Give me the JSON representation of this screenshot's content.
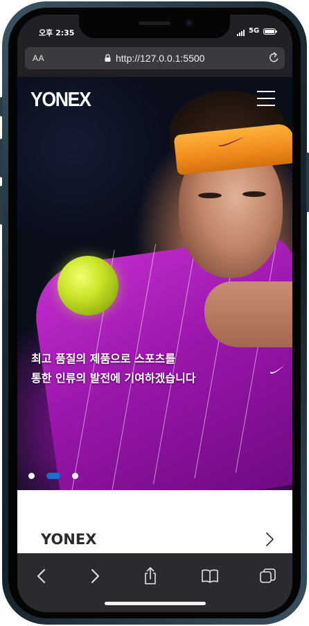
{
  "status_bar": {
    "time": "오후 2:35",
    "network": "5G"
  },
  "browser": {
    "text_size_label": "AA",
    "url": "http://127.0.0.1:5500"
  },
  "header": {
    "logo": "YONEX"
  },
  "hero": {
    "tagline_line1": "최고 품질의 제품으로 스포츠를",
    "tagline_line2": "통한 인류의 발전에 기여하겠습니다",
    "slides_total": 3,
    "active_slide": 2
  },
  "section": {
    "title": "YONEX"
  },
  "colors": {
    "accent_dot": "#1b6fce",
    "headband": "#f08a1c",
    "shirt": "#9a16ab"
  },
  "icons": [
    "lock-icon",
    "reload-icon",
    "hamburger-menu-icon",
    "chevron-right-icon",
    "back-icon",
    "forward-icon",
    "share-icon",
    "bookmarks-icon",
    "tabs-icon"
  ]
}
